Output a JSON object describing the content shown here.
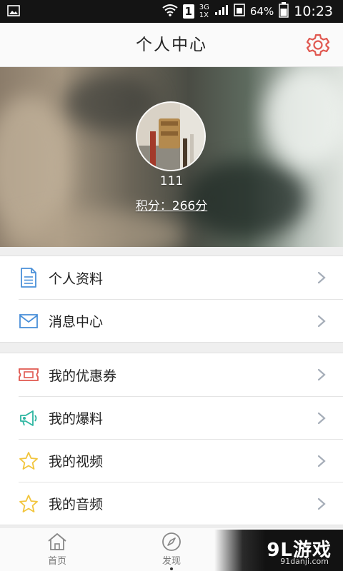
{
  "status_bar": {
    "sim_slot": "1",
    "network_top": "3G",
    "network_bottom": "1X",
    "battery_percent": "64%",
    "time": "10:23"
  },
  "header": {
    "title": "个人中心",
    "settings_icon": "gear-icon",
    "accent_color": "#e0574f"
  },
  "profile": {
    "username": "111",
    "points": "积分：266分"
  },
  "menu_group_1": [
    {
      "label": "个人资料",
      "icon": "document-icon"
    },
    {
      "label": "消息中心",
      "icon": "envelope-icon"
    }
  ],
  "menu_group_2": [
    {
      "label": "我的优惠券",
      "icon": "ticket-icon"
    },
    {
      "label": "我的爆料",
      "icon": "megaphone-icon"
    },
    {
      "label": "我的视频",
      "icon": "star-icon"
    },
    {
      "label": "我的音频",
      "icon": "star-icon"
    }
  ],
  "bottom_nav": [
    {
      "label": "首页",
      "icon": "home-icon"
    },
    {
      "label": "发现",
      "icon": "compass-icon",
      "active": true
    }
  ],
  "watermark": {
    "text": "9L游戏",
    "sub": "91danji.com"
  }
}
